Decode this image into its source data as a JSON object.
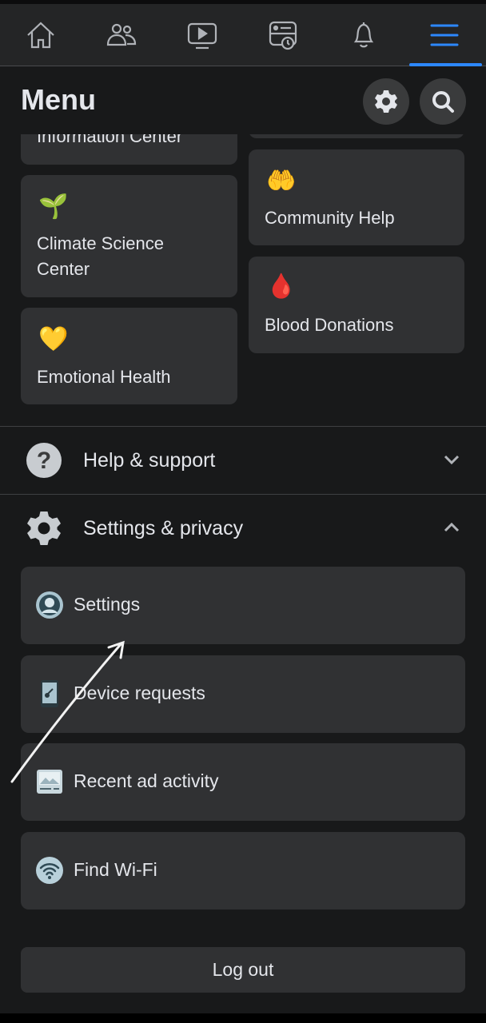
{
  "nav": {
    "tabs": [
      {
        "icon": "home-icon"
      },
      {
        "icon": "friends-icon"
      },
      {
        "icon": "watch-icon"
      },
      {
        "icon": "memories-icon"
      },
      {
        "icon": "bell-icon"
      },
      {
        "icon": "menu-icon",
        "active": true
      }
    ],
    "accent": "#2d88ff"
  },
  "header": {
    "title": "Menu",
    "settings_icon": "gear-icon",
    "search_icon": "search-icon"
  },
  "shortcuts": [
    {
      "label": "Information Center",
      "icon": "info-center-icon"
    },
    {
      "label": "Climate Science Center",
      "icon": "plant-globe-icon"
    },
    {
      "label": "Emotional Health",
      "icon": "heart-flower-icon"
    },
    {
      "label": "Community Help",
      "icon": "helping-hand-heart-icon"
    },
    {
      "label": "Blood Donations",
      "icon": "blood-drop-icon"
    }
  ],
  "sections": {
    "help": {
      "label": "Help & support",
      "icon": "question-icon",
      "expanded": false
    },
    "settings": {
      "label": "Settings & privacy",
      "icon": "gear-icon",
      "expanded": true,
      "items": [
        {
          "label": "Settings",
          "icon": "user-circle-icon"
        },
        {
          "label": "Device requests",
          "icon": "phone-key-icon"
        },
        {
          "label": "Recent ad activity",
          "icon": "ad-image-icon"
        },
        {
          "label": "Find Wi-Fi",
          "icon": "wifi-icon"
        }
      ]
    }
  },
  "logout": "Log out"
}
